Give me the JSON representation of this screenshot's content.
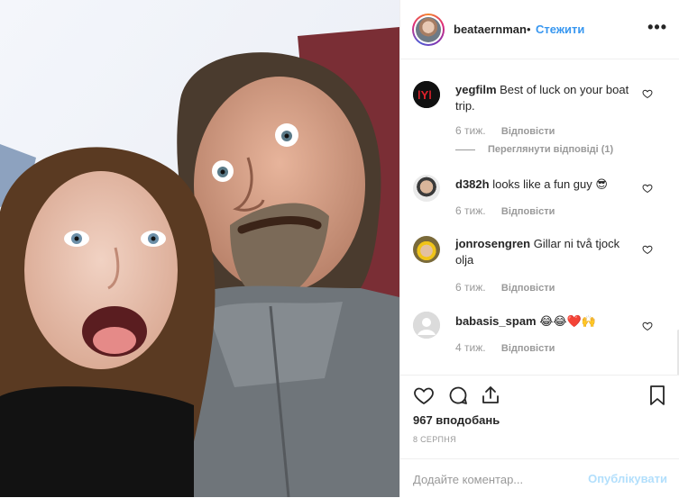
{
  "post": {
    "photo_description_icon": "selfie-photo",
    "header": {
      "username": "beataernman",
      "separator": "•",
      "follow_label": "Стежити",
      "more_label": "•••"
    },
    "comments": [
      {
        "username": "yegfilm",
        "text": "Best of luck on your boat trip.",
        "time": "6 тиж.",
        "reply_label": "Відповісти",
        "view_replies_label": "Переглянути відповіді (1)"
      },
      {
        "username": "d382h",
        "text": "looks like a fun guy 😎",
        "time": "6 тиж.",
        "reply_label": "Відповісти"
      },
      {
        "username": "jonrosengren",
        "text": "Gillar ni två tjock olja",
        "time": "6 тиж.",
        "reply_label": "Відповісти"
      },
      {
        "username": "babasis_spam",
        "text": "😂😂❤️🙌",
        "time": "4 тиж.",
        "reply_label": "Відповісти"
      }
    ],
    "likes_label": "967 вподобань",
    "date_label": "8 СЕРПНЯ",
    "add_comment": {
      "placeholder": "Додайте коментар...",
      "publish_label": "Опублікувати"
    },
    "colors": {
      "link_blue": "#3897f0",
      "publish_disabled": "#b2dffc",
      "muted_text": "#999999",
      "border": "#efefef"
    }
  }
}
